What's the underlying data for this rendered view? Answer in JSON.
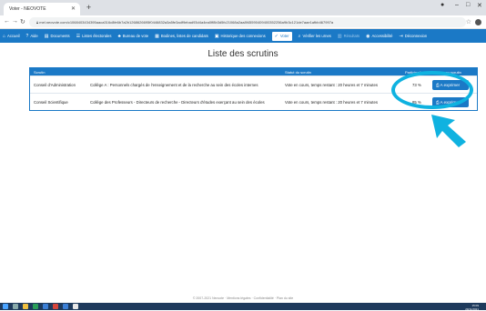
{
  "browser": {
    "tab_title": "Voter - NEOVOTE",
    "url": "mel.neovote.com/c1068403434395aaca316c8fe6b7a2b1268626695f0446832a3a5fe3adf9ebad93d4a4ea0ff8b3d5fc21068a2aa8f45590409400352256a9b3c121de7aae1afbb467997a"
  },
  "menu": {
    "items": [
      {
        "icon": "⌂",
        "label": "Accueil"
      },
      {
        "icon": "?",
        "label": "Aide"
      },
      {
        "icon": "▤",
        "label": "Documents"
      },
      {
        "icon": "☰",
        "label": "Listes électorales"
      },
      {
        "icon": "♣",
        "label": "Bureau de vote"
      },
      {
        "icon": "▦",
        "label": "Bodines, listes de candidats"
      },
      {
        "icon": "▣",
        "label": "Historique des connexions"
      },
      {
        "icon": "✓",
        "label": "Voter"
      },
      {
        "icon": "⌕",
        "label": "Vérifier les urnes"
      },
      {
        "icon": "▥",
        "label": "Résultats"
      },
      {
        "icon": "◉",
        "label": "Accessibilité"
      },
      {
        "icon": "⇥",
        "label": "Déconnexion"
      }
    ]
  },
  "page": {
    "title": "Liste des scrutins"
  },
  "table": {
    "headers": {
      "scrutin": "Scrutin",
      "statut": "Statut du scrutin",
      "participation": "Participation",
      "voter": "Voter au scrutin"
    },
    "rows": [
      {
        "name": "Conseil d'Administration",
        "college": "Collège A : Personnels chargés de l'enseignement et de la recherche au sein des écoles internes",
        "status": "Vote en cours, temps restant : 20 heures et 7 minutes",
        "participation": "73 %",
        "button": "A exprimer"
      },
      {
        "name": "Conseil Scientifique",
        "college": "Collège des Professeurs - Directeurs de recherche - Directeurs d'études exerçant au sein des écoles",
        "status": "Vote en cours, temps restant : 20 heures et 7 minutes",
        "participation": "85 %",
        "button": "A exprimer"
      }
    ]
  },
  "footer": {
    "text": "© 2007-2021 Neovote · Mentions légales · Confidentialité · Plan du site"
  },
  "taskbar": {
    "time": "15:09",
    "date": "29/11/2021"
  },
  "colors": {
    "accent": "#1b79c6",
    "highlight": "#0fb2e0"
  }
}
